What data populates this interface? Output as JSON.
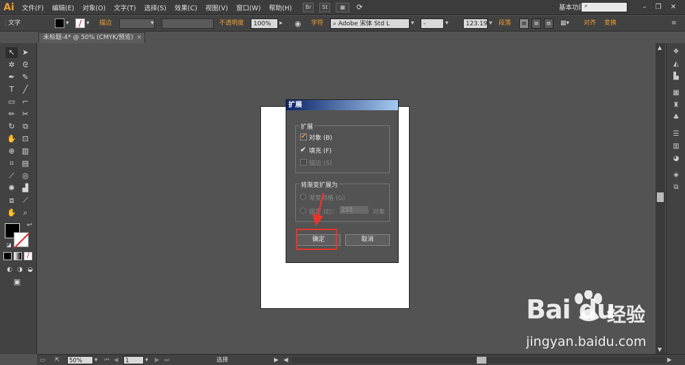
{
  "app": {
    "logo": "Ai",
    "workspace": "基本功能",
    "search_placeholder": ""
  },
  "menu": [
    "文件(F)",
    "编辑(E)",
    "对象(O)",
    "文字(T)",
    "选择(S)",
    "效果(C)",
    "视图(V)",
    "窗口(W)",
    "帮助(H)"
  ],
  "menu_extras": {
    "bridge": "Br",
    "stock": "St"
  },
  "control": {
    "mode_label": "文字",
    "stroke_label": "描边",
    "opacity_label": "不透明度",
    "opacity_value": "100%",
    "char_label": "字符",
    "font_value": "Adobe 宋体 Std L",
    "font_style": "-",
    "font_size": "123.19",
    "para_label": "段落",
    "align_label": "对齐",
    "transform_label": "变换"
  },
  "doc_tab": {
    "title": "未标题-4* @ 50% (CMYK/预览)",
    "close": "×"
  },
  "dialog": {
    "title": "扩展",
    "group1_label": "扩展",
    "opt_object": "对象 (B)",
    "opt_fill": "填充 (F)",
    "opt_stroke": "描边 (S)",
    "opt_object_checked": true,
    "opt_fill_checked": true,
    "opt_stroke_checked": false,
    "group2_label": "将渐变扩展为",
    "radio_mesh": "渐变网格 (G)",
    "radio_specify": "指定 (E)：",
    "specify_value": "255",
    "specify_unit": "对象",
    "ok_label": "确定",
    "cancel_label": "取消"
  },
  "status": {
    "zoom": "50%",
    "page": "1",
    "tool": "选择"
  },
  "watermark": {
    "logo_text": "Bai du",
    "logo_cn": "经验",
    "url": "jingyan.baidu.com"
  },
  "colors": {
    "highlight": "#e8352c",
    "accent": "#f0a030",
    "dialog_title_start": "#0a246a"
  }
}
